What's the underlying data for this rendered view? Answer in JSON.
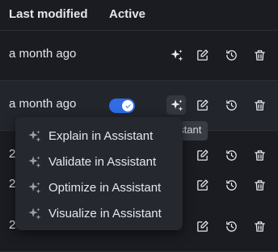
{
  "table": {
    "columns": [
      "Last modified",
      "Active"
    ],
    "rows": [
      {
        "modified": "a month ago",
        "active": null
      },
      {
        "modified": "a month ago",
        "active": true
      },
      {
        "modified": "2",
        "active": null
      },
      {
        "modified": "2",
        "active": null
      },
      {
        "modified": "2",
        "active": null
      }
    ],
    "row_actions": [
      "sparkle-icon",
      "edit-icon",
      "history-icon",
      "trash-icon"
    ]
  },
  "tooltip": {
    "text": "Ask Assistant"
  },
  "menu": {
    "items": [
      {
        "label": "Explain in Assistant",
        "icon": "sparkle-icon"
      },
      {
        "label": "Validate in Assistant",
        "icon": "sparkle-icon"
      },
      {
        "label": "Optimize in Assistant",
        "icon": "sparkle-icon"
      },
      {
        "label": "Visualize in Assistant",
        "icon": "sparkle-icon"
      }
    ]
  },
  "colors": {
    "background": "#1b1c22",
    "row_highlight": "#23252d",
    "menu_bg": "#26282f",
    "toggle_on": "#2f6ce6",
    "divider": "#2c2e37"
  }
}
